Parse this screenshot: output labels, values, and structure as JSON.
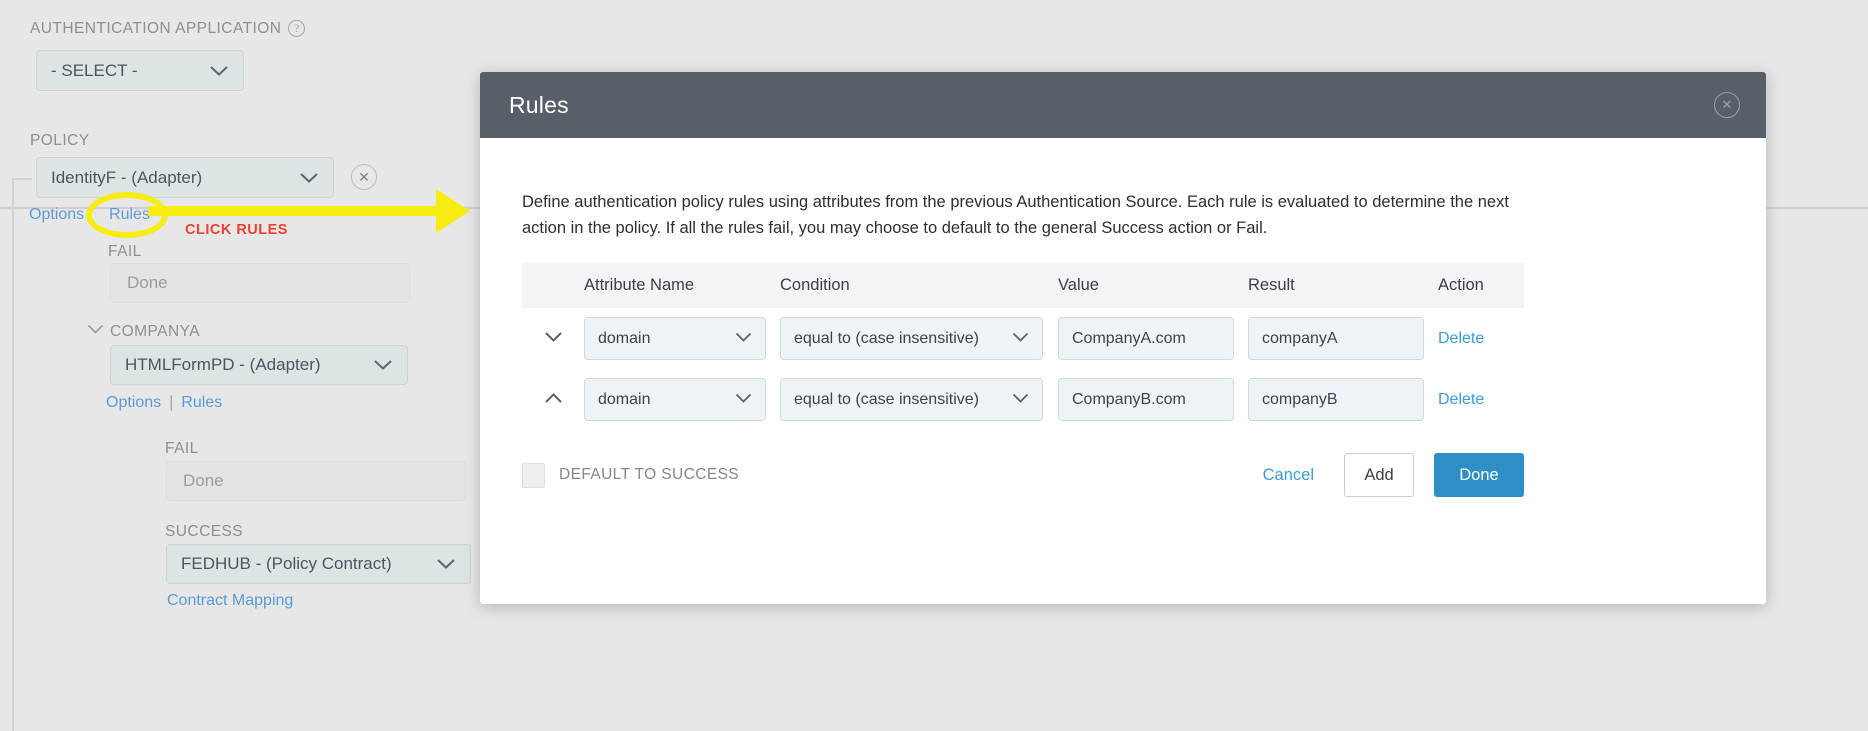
{
  "background": {
    "auth_app_label": "AUTHENTICATION APPLICATION",
    "auth_app_help_icon": "help-icon",
    "auth_app_value": "- SELECT -",
    "policy_label": "POLICY",
    "policy_value": "IdentityF - (Adapter)",
    "policy_links": {
      "options": "Options",
      "rules": "Rules"
    },
    "fail_label_1": "FAIL",
    "fail_value_1": "Done",
    "companya_label": "COMPANYA",
    "companya_value": "HTMLFormPD - (Adapter)",
    "companya_links": {
      "options": "Options",
      "separator": "|",
      "rules": "Rules"
    },
    "fail_label_2": "FAIL",
    "fail_value_2": "Done",
    "success_label": "SUCCESS",
    "success_value": "FEDHUB - (Policy Contract)",
    "contract_mapping_link": "Contract Mapping",
    "remove_icon": "close-x-icon"
  },
  "annotation": {
    "callout_text": "CLICK RULES",
    "highlight_color": "#f7ed13",
    "text_color": "#f13f2f",
    "target": "Rules"
  },
  "modal": {
    "title": "Rules",
    "close_icon": "close-circle-icon",
    "description": "Define authentication policy rules using attributes from the previous Authentication Source. Each rule is evaluated to determine the next action in the policy. If all the rules fail, you may choose to default to the general Success action or Fail.",
    "table": {
      "headers": {
        "toggle": "",
        "attribute_name": "Attribute Name",
        "condition": "Condition",
        "value": "Value",
        "result": "Result",
        "action": "Action"
      },
      "rows": [
        {
          "toggle_icon": "chevron-down-icon",
          "attribute_name": "domain",
          "condition": "equal to (case insensitive)",
          "value": "CompanyA.com",
          "result": "companyA",
          "action": "Delete"
        },
        {
          "toggle_icon": "chevron-up-icon",
          "attribute_name": "domain",
          "condition": "equal to (case insensitive)",
          "value": "CompanyB.com",
          "result": "companyB",
          "action": "Delete"
        }
      ]
    },
    "footer": {
      "default_to_success_label": "DEFAULT TO SUCCESS",
      "default_to_success_checked": false,
      "cancel_label": "Cancel",
      "add_label": "Add",
      "done_label": "Done",
      "done_color": "#2e8fc6"
    }
  }
}
